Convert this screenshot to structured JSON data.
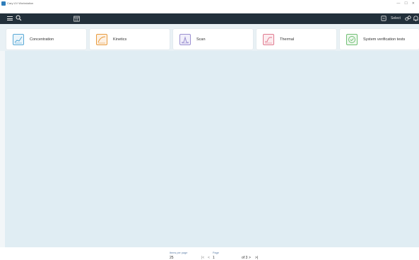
{
  "window": {
    "title": "Cary UV Workstation",
    "controls": [
      "—",
      "☐",
      "✕"
    ]
  },
  "toolbar": {
    "select_label": "Select"
  },
  "tiles": [
    {
      "label": "Concentration",
      "color": "#5aa9d6"
    },
    {
      "label": "Kinetics",
      "color": "#e89a3c"
    },
    {
      "label": "Scan",
      "color": "#9a8fd1"
    },
    {
      "label": "Thermal",
      "color": "#e07a8f"
    },
    {
      "label": "System verification tests",
      "color": "#6fbf73"
    }
  ],
  "footer": {
    "items_per_page_label": "Items per page",
    "items_per_page_value": "25",
    "page_label": "Page",
    "page_value": "1",
    "of_text": "of 3",
    "first": "|<",
    "prev": "<",
    "next": ">",
    "last": ">|"
  }
}
